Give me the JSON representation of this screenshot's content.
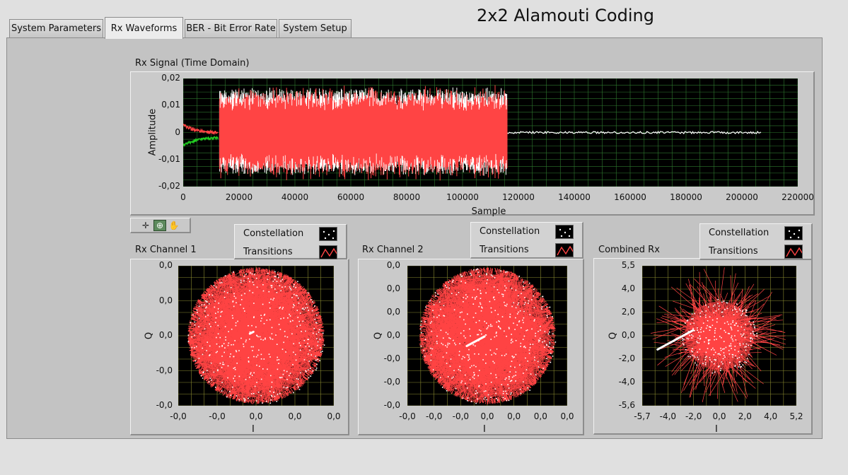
{
  "window": {
    "title": "2x2 Alamouti Coding"
  },
  "tabs": [
    {
      "label": "System Parameters",
      "active": false
    },
    {
      "label": "Rx Waveforms",
      "active": true
    },
    {
      "label": "BER - Bit Error Rate",
      "active": false
    },
    {
      "label": "System Setup",
      "active": false
    }
  ],
  "colors": {
    "trace_white": "#ffffff",
    "trace_red": "#ff4444",
    "trace_green": "#22cc22",
    "grid": "#2f7a2f",
    "grid_yellow": "#8a8a30",
    "plot_bg": "#000000",
    "panel_bg": "#c3c3c3"
  },
  "palette": {
    "icons": [
      "cursor-move-icon",
      "zoom-icon",
      "pan-hand-icon"
    ],
    "selected": "zoom-icon"
  },
  "time_graph": {
    "label": "Rx Signal (Time Domain)",
    "chart_data": {
      "type": "line",
      "title": "Rx Signal (Time Domain)",
      "xlabel": "Sample",
      "ylabel": "Amplitude",
      "xlim": [
        0,
        220000
      ],
      "ylim": [
        -0.02,
        0.02
      ],
      "x_ticks": [
        "0",
        "20000",
        "40000",
        "60000",
        "80000",
        "100000",
        "120000",
        "140000",
        "160000",
        "180000",
        "200000",
        "220000"
      ],
      "y_ticks": [
        "0,02",
        "0,01",
        "0",
        "-0,01",
        "-0,02"
      ],
      "grid": true,
      "series": [
        {
          "color": "#ffffff",
          "segments": [
            {
              "x0": 13000,
              "x1": 116000,
              "kind": "burst",
              "low": -0.016,
              "high": 0.017
            },
            {
              "x0": 116000,
              "x1": 207000,
              "kind": "flat",
              "y": 0.0
            }
          ]
        },
        {
          "color": "#ff4444",
          "segments": [
            {
              "x0": 0,
              "x1": 12500,
              "kind": "decay",
              "y_start": 0.003,
              "y_end": 0.0
            },
            {
              "x0": 13000,
              "x1": 116000,
              "kind": "burst",
              "low": -0.018,
              "high": 0.018
            }
          ]
        },
        {
          "color": "#22cc22",
          "segments": [
            {
              "x0": 0,
              "x1": 12500,
              "kind": "decay",
              "y_start": -0.005,
              "y_end": -0.002
            }
          ]
        }
      ]
    }
  },
  "constellations": [
    {
      "label": "Rx Channel 1",
      "legend": [
        {
          "label": "Constellation",
          "icon": "constellation-dots-icon"
        },
        {
          "label": "Transitions",
          "icon": "transitions-line-icon"
        }
      ],
      "chart_data": {
        "type": "scatter",
        "xlabel": "I",
        "ylabel": "Q",
        "x_ticks": [
          "-0,0",
          "-0,0",
          "0,0",
          "0,0",
          "0,0"
        ],
        "y_ticks": [
          "0,0",
          "0,0",
          "0,0",
          "-0,0",
          "-0,0"
        ],
        "shape": "circle",
        "radius": 1.0,
        "grid": true,
        "cluster_center": [
          -0.05,
          0.05
        ],
        "cluster_spread": 0.04
      }
    },
    {
      "label": "Rx Channel 2",
      "legend": [
        {
          "label": "Constellation",
          "icon": "constellation-dots-icon"
        },
        {
          "label": "Transitions",
          "icon": "transitions-line-icon"
        }
      ],
      "chart_data": {
        "type": "scatter",
        "xlabel": "I",
        "ylabel": "Q",
        "x_ticks": [
          "-0,0",
          "-0,0",
          "-0,0",
          "0,0",
          "0,0",
          "0,0",
          "0,0"
        ],
        "y_ticks": [
          "0,0",
          "0,0",
          "0,0",
          "0,0",
          "-0,0",
          "-0,0",
          "-0,0"
        ],
        "shape": "circle",
        "radius": 1.0,
        "grid": true,
        "cluster_center": [
          -0.1,
          -0.05
        ],
        "cluster_spread": 0.2
      }
    },
    {
      "label": "Combined Rx",
      "legend": [
        {
          "label": "Constellation",
          "icon": "constellation-dots-icon"
        },
        {
          "label": "Transitions",
          "icon": "transitions-line-icon"
        }
      ],
      "chart_data": {
        "type": "scatter",
        "xlabel": "I",
        "ylabel": "Q",
        "x_ticks": [
          "-5,7",
          "-4,0",
          "-2,0",
          "0,0",
          "2,0",
          "4,0",
          "5,2"
        ],
        "y_ticks": [
          "5,5",
          "4,0",
          "2,0",
          "0,0",
          "-2,0",
          "-4,0",
          "-5,6"
        ],
        "xlim": [
          -5.7,
          5.2
        ],
        "ylim": [
          -5.6,
          5.5
        ],
        "shape": "star",
        "radius": 1.0,
        "grid": true,
        "cluster_center": [
          -0.5,
          0.0
        ],
        "cluster_spread": 0.4
      }
    }
  ]
}
